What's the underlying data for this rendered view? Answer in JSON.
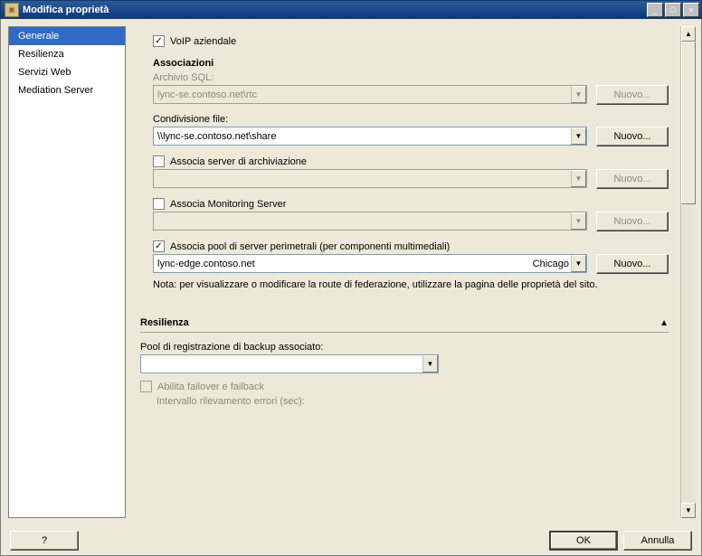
{
  "window": {
    "title": "Modifica proprietà",
    "controls": {
      "min": "_",
      "max": "□",
      "close": "×"
    }
  },
  "nav": {
    "items": [
      {
        "label": "Generale",
        "selected": true
      },
      {
        "label": "Resilienza",
        "selected": false
      },
      {
        "label": "Servizi Web",
        "selected": false
      },
      {
        "label": "Mediation Server",
        "selected": false
      }
    ]
  },
  "form": {
    "voip_check_label": "VoIP aziendale",
    "voip_checked": "✓",
    "assoc_header": "Associazioni",
    "sql_label": "Archivio SQL:",
    "sql_value": "lync-se.contoso.net\\rtc",
    "fileshare_label": "Condivisione file:",
    "fileshare_value": "\\\\lync-se.contoso.net\\share",
    "archiving_check_label": "Associa server di archiviazione",
    "archiving_value": "",
    "monitoring_check_label": "Associa Monitoring Server",
    "monitoring_value": "",
    "edge_check_label": "Associa pool di server perimetrali (per componenti multimediali)",
    "edge_checked": "✓",
    "edge_value": "lync-edge.contoso.net",
    "edge_location": "Chicago",
    "edge_note": "Nota: per visualizzare o modificare la route di federazione, utilizzare la pagina delle proprietà del sito.",
    "new_button": "Nuovo..."
  },
  "resilienza": {
    "header": "Resilienza",
    "backup_label": "Pool di registrazione di backup associato:",
    "backup_value": "",
    "failover_check_label": "Abilita failover e failback",
    "interval_label": "Intervallo rilevamento errori (sec):"
  },
  "footer": {
    "help": "?",
    "ok": "OK",
    "cancel": "Annulla"
  }
}
